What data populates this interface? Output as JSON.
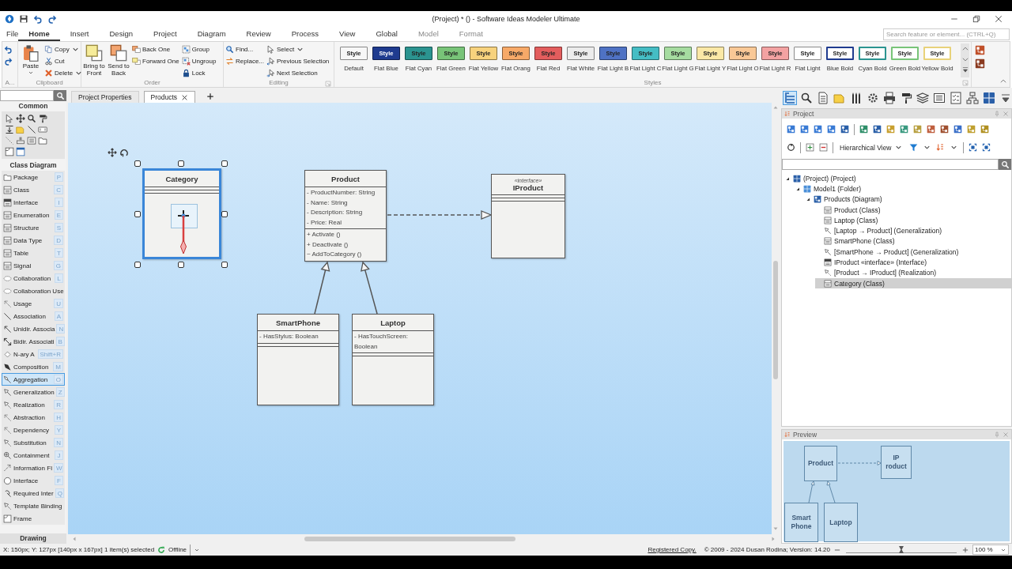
{
  "window": {
    "title": "(Project) * () - Software Ideas Modeler Ultimate"
  },
  "menu_tabs": [
    {
      "label": "File",
      "selected": false,
      "contextual": false
    },
    {
      "label": "Home",
      "selected": true,
      "contextual": false
    },
    {
      "label": "Insert",
      "selected": false,
      "contextual": false
    },
    {
      "label": "Design",
      "selected": false,
      "contextual": false
    },
    {
      "label": "Project",
      "selected": false,
      "contextual": false
    },
    {
      "label": "Diagram",
      "selected": false,
      "contextual": false
    },
    {
      "label": "Review",
      "selected": false,
      "contextual": false
    },
    {
      "label": "Process",
      "selected": false,
      "contextual": false
    },
    {
      "label": "View",
      "selected": false,
      "contextual": false
    },
    {
      "label": "Global",
      "selected": false,
      "contextual": false
    },
    {
      "label": "Model",
      "selected": false,
      "contextual": true
    },
    {
      "label": "Format",
      "selected": false,
      "contextual": true
    }
  ],
  "search": {
    "placeholder": "Search feature or element... (CTRL+Q)"
  },
  "ribbon": {
    "groups": [
      {
        "label": "A...",
        "columns": [
          [
            {
              "kind": "undo"
            },
            {
              "kind": "redo"
            }
          ]
        ]
      },
      {
        "label": "Clipboard",
        "columns": [
          [
            {
              "kind": "paste",
              "label": "Paste",
              "large": true,
              "dropdown": true
            }
          ],
          [
            {
              "kind": "copy",
              "label": "Copy",
              "dropdown": true
            },
            {
              "kind": "cut",
              "label": "Cut"
            },
            {
              "kind": "delete",
              "label": "Delete",
              "dropdown": true
            }
          ]
        ]
      },
      {
        "label": "Order",
        "columns": [
          [
            {
              "kind": "front",
              "label": "Bring to Front",
              "large": true
            }
          ],
          [
            {
              "kind": "back",
              "label": "Send to Back",
              "large": true
            }
          ],
          [
            {
              "kind": "backward",
              "label": "Back One"
            },
            {
              "kind": "forward",
              "label": "Forward One"
            }
          ],
          [
            {
              "kind": "group",
              "label": "Group"
            },
            {
              "kind": "ungroup",
              "label": "Ungroup"
            },
            {
              "kind": "lock",
              "label": "Lock"
            }
          ]
        ]
      },
      {
        "label": "Editing",
        "launcher": true,
        "columns": [
          [
            {
              "kind": "find",
              "label": "Find..."
            },
            {
              "kind": "replace",
              "label": "Replace..."
            }
          ],
          [
            {
              "kind": "select",
              "label": "Select",
              "dropdown": true
            },
            {
              "kind": "previous",
              "label": "Previous Selection"
            },
            {
              "kind": "next",
              "label": "Next Selection"
            }
          ]
        ]
      }
    ]
  },
  "styles": {
    "label": "Styles",
    "launcher": true,
    "items": [
      {
        "text": "Style",
        "caption": "Default",
        "kind": "fill",
        "color": "#f7f7f7"
      },
      {
        "text": "Style",
        "caption": "Flat Blue",
        "kind": "fill",
        "color": "#1f3b8f"
      },
      {
        "text": "Style",
        "caption": "Flat Cyan",
        "kind": "fill",
        "color": "#2b9490"
      },
      {
        "text": "Style",
        "caption": "Flat Green",
        "kind": "fill",
        "color": "#78c478"
      },
      {
        "text": "Style",
        "caption": "Flat Yellow",
        "kind": "fill",
        "color": "#f7d27d"
      },
      {
        "text": "Style",
        "caption": "Flat Orang",
        "kind": "fill",
        "color": "#f7a968"
      },
      {
        "text": "Style",
        "caption": "Flat Red",
        "kind": "fill",
        "color": "#e35d5d"
      },
      {
        "text": "Style",
        "caption": "Flat White",
        "kind": "fill",
        "color": "#ececec"
      },
      {
        "text": "Style",
        "caption": "Flat Light B",
        "kind": "fill",
        "color": "#4f72c4"
      },
      {
        "text": "Style",
        "caption": "Flat Light C",
        "kind": "fill",
        "color": "#45bdc4"
      },
      {
        "text": "Style",
        "caption": "Flat Light G",
        "kind": "fill",
        "color": "#a6dca0"
      },
      {
        "text": "Style",
        "caption": "Flat Light Y",
        "kind": "fill",
        "color": "#fbe8a6"
      },
      {
        "text": "Style",
        "caption": "Flat Light O",
        "kind": "fill",
        "color": "#f9c896"
      },
      {
        "text": "Style",
        "caption": "Flat Light R",
        "kind": "fill",
        "color": "#f3a2a2"
      },
      {
        "text": "Style",
        "caption": "Flat Light",
        "kind": "fill",
        "color": "#ffffff"
      },
      {
        "text": "Style",
        "caption": "Blue Bold",
        "kind": "bold",
        "color": "#1f3b8f"
      },
      {
        "text": "Style",
        "caption": "Cyan Bold",
        "kind": "bold",
        "color": "#2b9490"
      },
      {
        "text": "Style",
        "caption": "Green Bold",
        "kind": "bold",
        "color": "#78c478"
      },
      {
        "text": "Style",
        "caption": "Yellow Bold",
        "kind": "bold",
        "color": "#e8d27a"
      }
    ]
  },
  "toolbox": {
    "common_title": "Common",
    "class_title": "Class Diagram",
    "footer": "Drawing",
    "items": [
      {
        "label": "Package",
        "key": "P",
        "selected": false
      },
      {
        "label": "Class",
        "key": "C",
        "selected": false
      },
      {
        "label": "Interface",
        "key": "I",
        "selected": false
      },
      {
        "label": "Enumeration",
        "key": "E",
        "selected": false
      },
      {
        "label": "Structure",
        "key": "S",
        "selected": false
      },
      {
        "label": "Data Type",
        "key": "D",
        "selected": false
      },
      {
        "label": "Table",
        "key": "T",
        "selected": false
      },
      {
        "label": "Signal",
        "key": "G",
        "selected": false
      },
      {
        "label": "Collaboration",
        "key": "L",
        "selected": false
      },
      {
        "label": "Collaboration Use",
        "selected": false
      },
      {
        "label": "Usage",
        "key": "U",
        "selected": false
      },
      {
        "label": "Association",
        "key": "A",
        "selected": false
      },
      {
        "label": "Unidir. Associa",
        "key": "N",
        "selected": false
      },
      {
        "label": "Bidir. Associati",
        "key": "B",
        "selected": false
      },
      {
        "label": "N-ary A",
        "key": "Shift+R",
        "selected": false
      },
      {
        "label": "Composition",
        "key": "M",
        "selected": false
      },
      {
        "label": "Aggregation",
        "key": "O",
        "selected": true
      },
      {
        "label": "Generalization",
        "key": "Z",
        "selected": false
      },
      {
        "label": "Realization",
        "key": "R",
        "selected": false
      },
      {
        "label": "Abstraction",
        "key": "H",
        "selected": false
      },
      {
        "label": "Dependency",
        "key": "Y",
        "selected": false
      },
      {
        "label": "Substitution",
        "key": "N",
        "selected": false
      },
      {
        "label": "Containment",
        "key": "J",
        "selected": false
      },
      {
        "label": "Information Fl",
        "key": "W",
        "selected": false
      },
      {
        "label": "Interface",
        "key": "F",
        "selected": false
      },
      {
        "label": "Required Inter",
        "key": "Q",
        "selected": false
      },
      {
        "label": "Template Binding",
        "selected": false
      },
      {
        "label": "Frame",
        "selected": false
      }
    ]
  },
  "doc_tabs": [
    {
      "label": "Project Properties",
      "selected": false
    },
    {
      "label": "Products",
      "selected": true,
      "closable": true
    }
  ],
  "diagram": {
    "classes": [
      {
        "name": "Category",
        "selected": true
      },
      {
        "name": "Product",
        "selected": false,
        "attributes": [
          "- ProductNumber: String",
          "- Name: String",
          "- Description: String",
          "- Price: Real"
        ],
        "operations": [
          "+ Activate ()",
          "+ Deactivate ()",
          "~ AddToCategory ()"
        ]
      },
      {
        "name": "IProduct",
        "stereotype": "«interface»",
        "selected": false
      },
      {
        "name": "SmartPhone",
        "selected": false,
        "attributes": [
          "- HasStylus: Boolean"
        ]
      },
      {
        "name": "Laptop",
        "selected": false,
        "attributes": [
          "- HasTouchScreen: Boolean"
        ]
      }
    ],
    "connectors": [
      {
        "kind": "generalization"
      },
      {
        "kind": "generalization"
      },
      {
        "kind": "realization"
      }
    ],
    "draft_connector": {
      "kind": "aggregation"
    }
  },
  "project": {
    "title": "Project",
    "view": "Hierarchical View",
    "tree": [
      {
        "label": "(Project) (Project)",
        "kind": "project",
        "selected": false,
        "expanded": true,
        "children": [
          {
            "label": "Model1 (Folder)",
            "kind": "folder",
            "selected": false,
            "expanded": true,
            "children": [
              {
                "label": "Products (Diagram)",
                "kind": "diagram",
                "selected": false,
                "expanded": true,
                "children": [
                  {
                    "label": "Product (Class)",
                    "kind": "class",
                    "selected": false
                  },
                  {
                    "label": "Laptop (Class)",
                    "kind": "class",
                    "selected": false
                  },
                  {
                    "label": "[Laptop → Product] (Generalization)",
                    "kind": "generalization",
                    "selected": false
                  },
                  {
                    "label": "SmartPhone (Class)",
                    "kind": "class",
                    "selected": false
                  },
                  {
                    "label": "[SmartPhone → Product] (Generalization)",
                    "kind": "generalization",
                    "selected": false
                  },
                  {
                    "label": "IProduct «interface» (Interface)",
                    "kind": "interface",
                    "selected": false
                  },
                  {
                    "label": "[Product → IProduct] (Realization)",
                    "kind": "realization",
                    "selected": false
                  },
                  {
                    "label": "Category (Class)",
                    "kind": "class",
                    "selected": true
                  }
                ]
              }
            ]
          }
        ]
      }
    ]
  },
  "preview": {
    "title": "Preview",
    "classes": [
      "Product",
      "IP roduct",
      "Smart Phone",
      "Laptop"
    ]
  },
  "status": {
    "position": "X: 150px; Y: 127px  [140px x 167px] 1 item(s) selected",
    "connection": "Offline",
    "registration": "Registered Copy.",
    "copyright": "© 2009 - 2024 Dusan Rodina; Version: 14.20",
    "zoom": {
      "level": 0.5,
      "value": "100 %"
    }
  }
}
